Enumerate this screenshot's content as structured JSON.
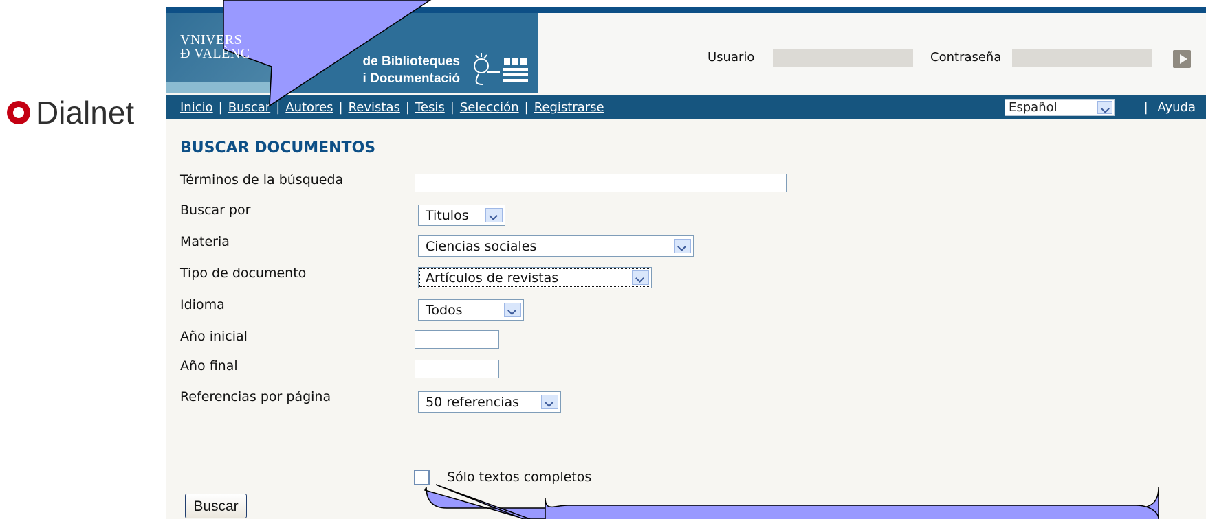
{
  "dialnet": {
    "brand": "Dialnet",
    "icon": "dialnet-logo-icon"
  },
  "header": {
    "university": "VNIVERS\nÐ VALÈNC",
    "library": "de Biblioteques\ni Documentació",
    "icon": "library-logo-icon",
    "login": {
      "user_label": "Usuario",
      "user_value": "",
      "password_label": "Contraseña",
      "password_value": "",
      "submit_icon": "play-arrow-icon"
    }
  },
  "navigation": {
    "items": [
      "Inicio",
      "Buscar",
      "Autores",
      "Revistas",
      "Tesis",
      "Selección",
      "Registrarse"
    ],
    "separator": "|",
    "language": "Español",
    "help": "Ayuda"
  },
  "search": {
    "title": "BUSCAR DOCUMENTOS",
    "terms_label": "Términos de la búsqueda",
    "terms_value": "",
    "search_by_label": "Buscar por",
    "search_by_value": "Titulos",
    "subject_label": "Materia",
    "subject_value": "Ciencias sociales",
    "document_type_label": "Tipo de documento",
    "document_type_value": "Artículos de revistas",
    "language_label": "Idioma",
    "language_value": "Todos",
    "start_year_label": "Año inicial",
    "start_year_value": "",
    "end_year_label": "Año final",
    "end_year_value": "",
    "references_label": "Referencias por página",
    "references_value": "50 referencias",
    "full_text_label": "Sólo textos completos",
    "full_text_checked": false,
    "submit_label": "Buscar"
  },
  "colors": {
    "brand_red": "#c40012",
    "header_blue": "#0d4f86",
    "nav_blue": "#16557f",
    "callout_fill": "#9999ff"
  }
}
